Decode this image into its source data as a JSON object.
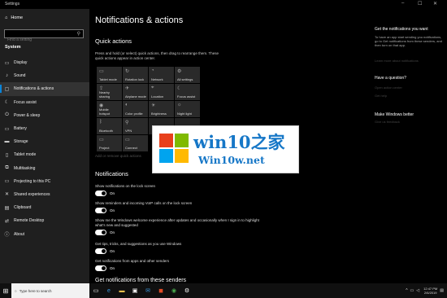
{
  "window": {
    "title": "Settings",
    "controls": [
      "–",
      "☐",
      "✕"
    ]
  },
  "sidebar": {
    "home": "Home",
    "search_placeholder": "Find a setting",
    "section": "System",
    "items": [
      {
        "label": "Display",
        "icon": "display-icon",
        "glyph": "▭"
      },
      {
        "label": "Sound",
        "icon": "sound-icon",
        "glyph": "♪"
      },
      {
        "label": "Notifications & actions",
        "icon": "notifications-icon",
        "glyph": "▢"
      },
      {
        "label": "Focus assist",
        "icon": "moon-icon",
        "glyph": "☾"
      },
      {
        "label": "Power & sleep",
        "icon": "power-icon",
        "glyph": "⏻"
      },
      {
        "label": "Battery",
        "icon": "battery-icon",
        "glyph": "▭"
      },
      {
        "label": "Storage",
        "icon": "storage-icon",
        "glyph": "▬"
      },
      {
        "label": "Tablet mode",
        "icon": "tablet-icon",
        "glyph": "▯"
      },
      {
        "label": "Multitasking",
        "icon": "multitasking-icon",
        "glyph": "⧉"
      },
      {
        "label": "Projecting to this PC",
        "icon": "projecting-icon",
        "glyph": "▭"
      },
      {
        "label": "Shared experiences",
        "icon": "shared-icon",
        "glyph": "✕"
      },
      {
        "label": "Clipboard",
        "icon": "clipboard-icon",
        "glyph": "▤"
      },
      {
        "label": "Remote Desktop",
        "icon": "remote-desktop-icon",
        "glyph": "⇄"
      },
      {
        "label": "About",
        "icon": "info-icon",
        "glyph": "ⓘ"
      }
    ],
    "active_index": 2
  },
  "main": {
    "title": "Notifications & actions",
    "quick_actions_heading": "Quick actions",
    "quick_actions_desc": "Press and hold (or select) quick actions, then drag to rearrange them. These quick actions appear in action center.",
    "tiles": [
      {
        "label": "Tablet mode",
        "icon": "tablet-mode-icon",
        "glyph": "▭"
      },
      {
        "label": "Rotation lock",
        "icon": "rotation-lock-icon",
        "glyph": "↻"
      },
      {
        "label": "Network",
        "icon": "network-icon",
        "glyph": "◔"
      },
      {
        "label": "All settings",
        "icon": "settings-icon",
        "glyph": "⚙"
      },
      {
        "label": "Nearby sharing",
        "icon": "nearby-sharing-icon",
        "glyph": "⇪"
      },
      {
        "label": "Airplane mode",
        "icon": "airplane-icon",
        "glyph": "✈"
      },
      {
        "label": "Location",
        "icon": "location-icon",
        "glyph": "⌖"
      },
      {
        "label": "Focus assist",
        "icon": "focus-assist-icon",
        "glyph": "☾"
      },
      {
        "label": "Mobile hotspot",
        "icon": "hotspot-icon",
        "glyph": "◉"
      },
      {
        "label": "Color profile",
        "icon": "color-profile-icon",
        "glyph": "◐"
      },
      {
        "label": "Brightness",
        "icon": "brightness-icon",
        "glyph": "☀"
      },
      {
        "label": "Night light",
        "icon": "night-light-icon",
        "glyph": "☼"
      },
      {
        "label": "Bluetooth",
        "icon": "bluetooth-icon",
        "glyph": "ᛒ"
      },
      {
        "label": "VPN",
        "icon": "vpn-icon",
        "glyph": "⚲"
      },
      {
        "label": "",
        "icon": "",
        "glyph": ""
      },
      {
        "label": "",
        "icon": "",
        "glyph": ""
      },
      {
        "label": "Project",
        "icon": "project-icon",
        "glyph": "▭"
      },
      {
        "label": "Connect",
        "icon": "connect-icon",
        "glyph": "▭"
      }
    ],
    "add_remove": "Add or remove quick actions",
    "notifications_heading": "Notifications",
    "options": [
      {
        "label": "Show notifications on the lock screen",
        "state": "On"
      },
      {
        "label": "Show reminders and incoming VoIP calls on the lock screen",
        "state": "On"
      },
      {
        "label": "Show me the Windows welcome experience after updates and occasionally when I sign in to highlight what's new and suggested",
        "state": "On"
      },
      {
        "label": "Get tips, tricks, and suggestions as you use Windows",
        "state": "On"
      },
      {
        "label": "Get notifications from apps and other senders",
        "state": "On"
      }
    ],
    "cutoff_heading": "Get notifications from these senders"
  },
  "right_panel": {
    "heading1": "Get the notifications you want",
    "desc1": "To have an app start sending you notifications, go to Get notifications from these senders, and then turn on that app.",
    "link1": "Learn more about notifications",
    "heading2": "Have a question?",
    "link2": "Open action center",
    "link3": "Get help",
    "heading3": "Make Windows better",
    "link4": "Give us feedback"
  },
  "watermark": {
    "line1": "win10之家",
    "line2": "Win10w.net"
  },
  "taskbar": {
    "search_placeholder": "Type here to search",
    "time": "12:47 PM",
    "date": "2/6/2019"
  }
}
